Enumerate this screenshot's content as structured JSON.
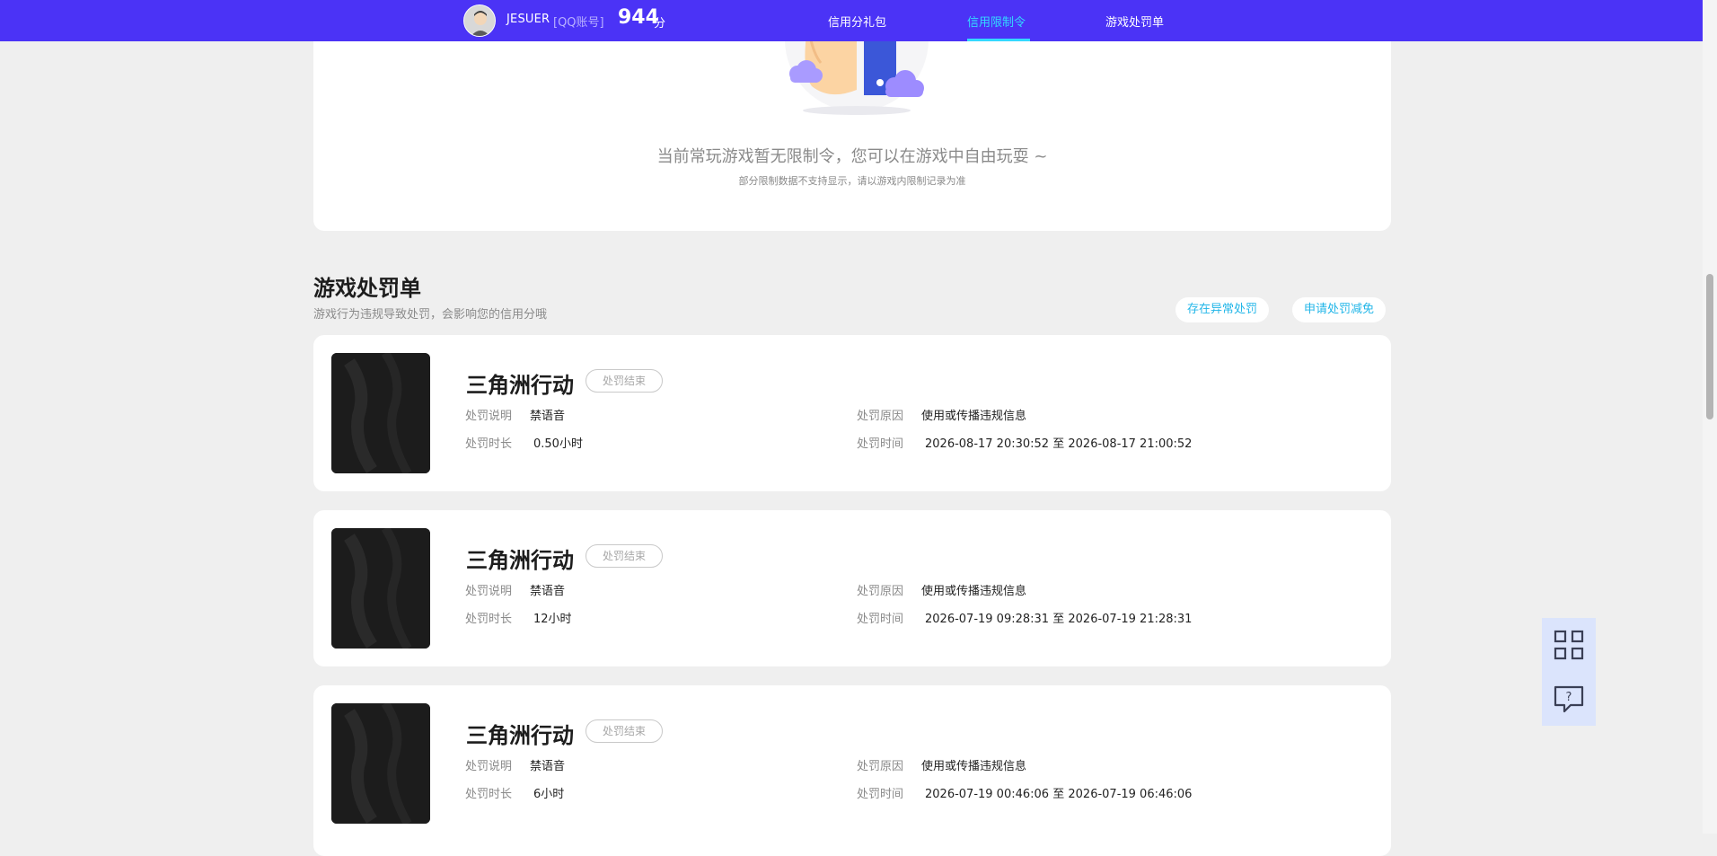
{
  "header": {
    "username": "JESUER",
    "account_tag": "[QQ账号]",
    "score_value": "944",
    "score_unit": "分",
    "nav": [
      {
        "label": "信用分礼包",
        "active": false
      },
      {
        "label": "信用限制令",
        "active": true
      },
      {
        "label": "游戏处罚单",
        "active": false
      }
    ]
  },
  "empty_state": {
    "message": "当前常玩游戏暂无限制令，您可以在游戏中自由玩耍 ~",
    "note": "部分限制数据不支持显示，请以游戏内限制记录为准"
  },
  "penalty_section": {
    "title": "游戏处罚单",
    "subtitle": "游戏行为违规导致处罚，会影响您的信用分哦",
    "actions": [
      "存在异常处罚",
      "申请处罚减免"
    ]
  },
  "labels": {
    "desc": "处罚说明",
    "reason": "处罚原因",
    "duration": "处罚时长",
    "time": "处罚时间",
    "time_sep": "至"
  },
  "penalties": [
    {
      "game": "三角洲行动",
      "status": "处罚结束",
      "desc": "禁语音",
      "reason": "使用或传播违规信息",
      "duration": "0.50小时",
      "start": "2026-08-17 20:30:52",
      "end": "2026-08-17 21:00:52"
    },
    {
      "game": "三角洲行动",
      "status": "处罚结束",
      "desc": "禁语音",
      "reason": "使用或传播违规信息",
      "duration": "12小时",
      "start": "2026-07-19 09:28:31",
      "end": "2026-07-19 21:28:31"
    },
    {
      "game": "三角洲行动",
      "status": "处罚结束",
      "desc": "禁语音",
      "reason": "使用或传播违规信息",
      "duration": "6小时",
      "start": "2026-07-19 00:46:06",
      "end": "2026-07-19 06:46:06"
    }
  ],
  "side_tools": [
    {
      "icon": "qr-code-icon"
    },
    {
      "icon": "help-chat-icon"
    }
  ],
  "colors": {
    "nav_bg": "#4b33f6",
    "accent": "#34d9ff",
    "link": "#22b6e8",
    "page_bg": "#efefef"
  }
}
